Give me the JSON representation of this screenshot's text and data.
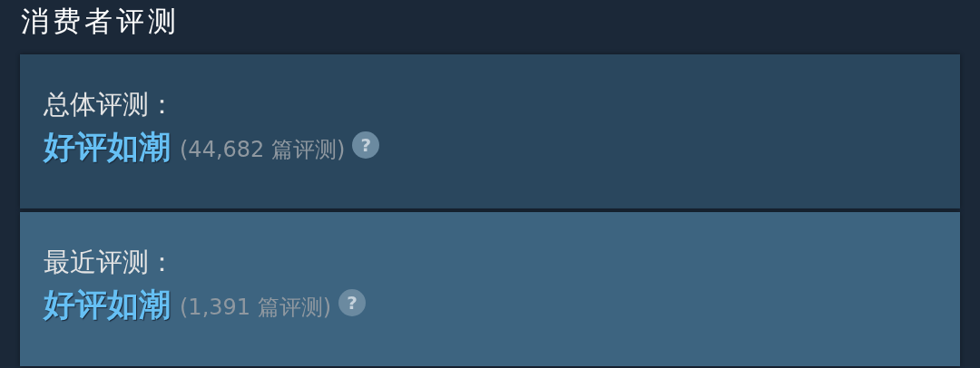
{
  "heading": "消费者评测",
  "panels": [
    {
      "kind": "overall",
      "label": "总体评测：",
      "rating": "好评如潮",
      "count": "(44,682 篇评测)",
      "help": "?"
    },
    {
      "kind": "recent",
      "label": "最近评测：",
      "rating": "好评如潮",
      "count": "(1,391 篇评测)",
      "help": "?"
    }
  ]
}
